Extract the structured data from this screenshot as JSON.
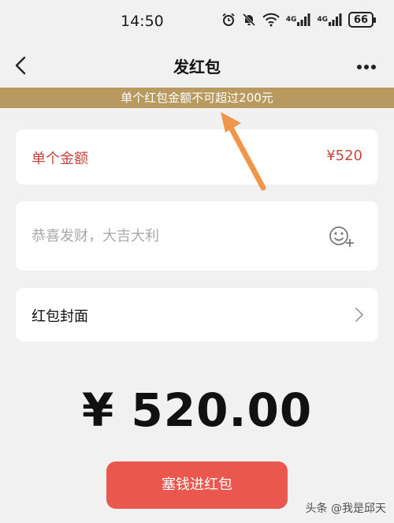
{
  "status_bar": {
    "time": "14:50",
    "icons": [
      "alarm-icon",
      "mute-icon",
      "wifi-icon",
      "signal-4g-icon",
      "signal-4g-icon",
      "battery-icon"
    ],
    "network_1": "4G",
    "network_2": "4G",
    "battery_level": "66"
  },
  "nav": {
    "title": "发红包",
    "back_icon": "chevron-left-icon",
    "more_icon": "more-dots-icon"
  },
  "notice": {
    "text": "单个红包金额不可超过200元"
  },
  "amount_row": {
    "label": "单个金额",
    "value": "¥520"
  },
  "greeting": {
    "placeholder": "恭喜发财，大吉大利",
    "value": "",
    "emoji_icon": "emoji-add-icon"
  },
  "cover_row": {
    "label": "红包封面",
    "chevron_icon": "chevron-right-icon"
  },
  "total": {
    "display": "¥ 520.00"
  },
  "actions": {
    "send_label": "塞钱进红包"
  },
  "watermark": {
    "text": "头条 @我是邱天"
  },
  "colors": {
    "notice_bg": "#b89a60",
    "amount_text": "#c4473f",
    "send_button": "#e9574f",
    "annotation_arrow": "#f0964a",
    "page_bg": "#f1f1f1"
  }
}
